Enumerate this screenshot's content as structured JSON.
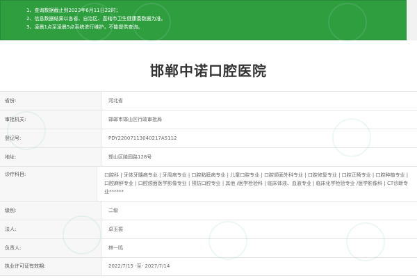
{
  "notice": {
    "items": [
      "1、查询数据截止到2023年6月11日22时；",
      "2、信息数据结果以各省、自治区、直辖市卫生健康委数据为准。",
      "3、凌晨1点至凌晨5点系统进行维护，不能提供查询。"
    ]
  },
  "hospital": {
    "name": "邯郸中诺口腔医院"
  },
  "details": {
    "province": {
      "label": "省份:",
      "value": "河北省"
    },
    "authority": {
      "label": "审批机关:",
      "value": "邯郸市邯山区行政审批局"
    },
    "reg_no": {
      "label": "登记号:",
      "value": "PDY22007113040217A5112"
    },
    "address": {
      "label": "地址:",
      "value": "邯山区陵园路128号"
    },
    "scope": {
      "label": "诊疗科目:",
      "value": "口腔科 | 牙体牙髓病专业 | 牙周病专业 | 口腔粘膜病专业 | 儿童口腔专业 | 口腔颌面外科专业 | 口腔修复专业 | 口腔正畸专业 | 口腔种植专业 | 口腔麻醉专业 | 口腔颌面医学影像专业 | 预防口腔专业 | 其他 /医学检验科 | 临床体液、血液专业 | 临床化学检验专业 /医学影像科 | CT诊断专业******"
    },
    "level": {
      "label": "级别:",
      "value": "二级"
    },
    "legal_person": {
      "label": "法人:",
      "value": "卓玉振"
    },
    "person_in_charge": {
      "label": "负责人:",
      "value": "林一鸣"
    },
    "license_period": {
      "label": "执业许可证有效期:",
      "value": "2022/7/15 -至- 2027/7/14"
    }
  }
}
